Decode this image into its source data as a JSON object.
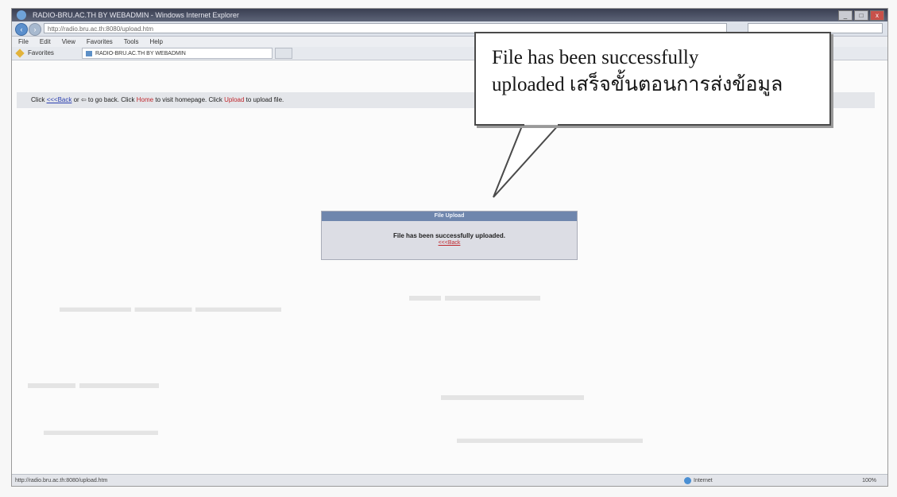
{
  "window": {
    "title": "RADIO-BRU.AC.TH BY WEBADMIN - Windows Internet Explorer",
    "url": "http://radio.bru.ac.th:8080/upload.htm",
    "controls": {
      "minimize": "_",
      "maximize": "□",
      "close": "x"
    }
  },
  "menu": [
    "File",
    "Edit",
    "View",
    "Favorites",
    "Tools",
    "Help"
  ],
  "favorites": {
    "label": "Favorites",
    "tab_title": "RADIO-BRU.AC.TH BY WEBADMIN"
  },
  "infobar": {
    "click1": "Click ",
    "goback": "<<<Back",
    "or": " or ",
    "mid": " to go back. Click ",
    "home": "Home",
    "visit": " to visit homepage. Click ",
    "upload": "Upload",
    "end": " to upload file."
  },
  "dialog": {
    "header": "File Upload",
    "message": "File has been successfully uploaded.",
    "back_link": "<<<Back"
  },
  "statusbar": {
    "url": "http://radio.bru.ac.th:8080/upload.htm",
    "zone": "Internet",
    "zoom": "100%"
  },
  "callout": {
    "line1": "File has been successfully",
    "line2": "uploaded เสร็จขั้นตอนการส่งข้อมูล"
  }
}
